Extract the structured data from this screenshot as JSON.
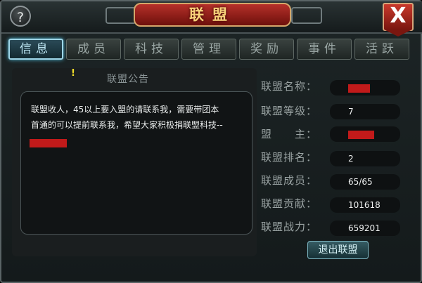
{
  "window": {
    "title": "联盟",
    "help_icon": "?",
    "close_icon": "X"
  },
  "tabs": [
    {
      "label": "信息",
      "active": true
    },
    {
      "label": "成员"
    },
    {
      "label": "科技"
    },
    {
      "label": "管理"
    },
    {
      "label": "奖励"
    },
    {
      "label": "事件"
    },
    {
      "label": "活跃"
    }
  ],
  "notice": {
    "marker": "!",
    "title": "联盟公告",
    "line1": "联盟收人，45以上要入盟的请联系我，需要带团本",
    "line2": "首通的可以提前联系我，希望大家积极捐联盟科技--"
  },
  "info": {
    "name_label": "联盟名称：",
    "level_label": "联盟等级：",
    "level_value": "7",
    "leader_label": "盟　　主：",
    "rank_label": "联盟排名：",
    "rank_value": "2",
    "members_label": "联盟成员：",
    "members_value": "65/65",
    "contribution_label": "联盟贡献：",
    "contribution_value": "101618",
    "power_label": "联盟战力：",
    "power_value": "659201"
  },
  "leave_button": "退出联盟",
  "colors": {
    "accent": "#9fd6e8",
    "title_red": "#b5302a",
    "redaction": "#c11a1a"
  }
}
